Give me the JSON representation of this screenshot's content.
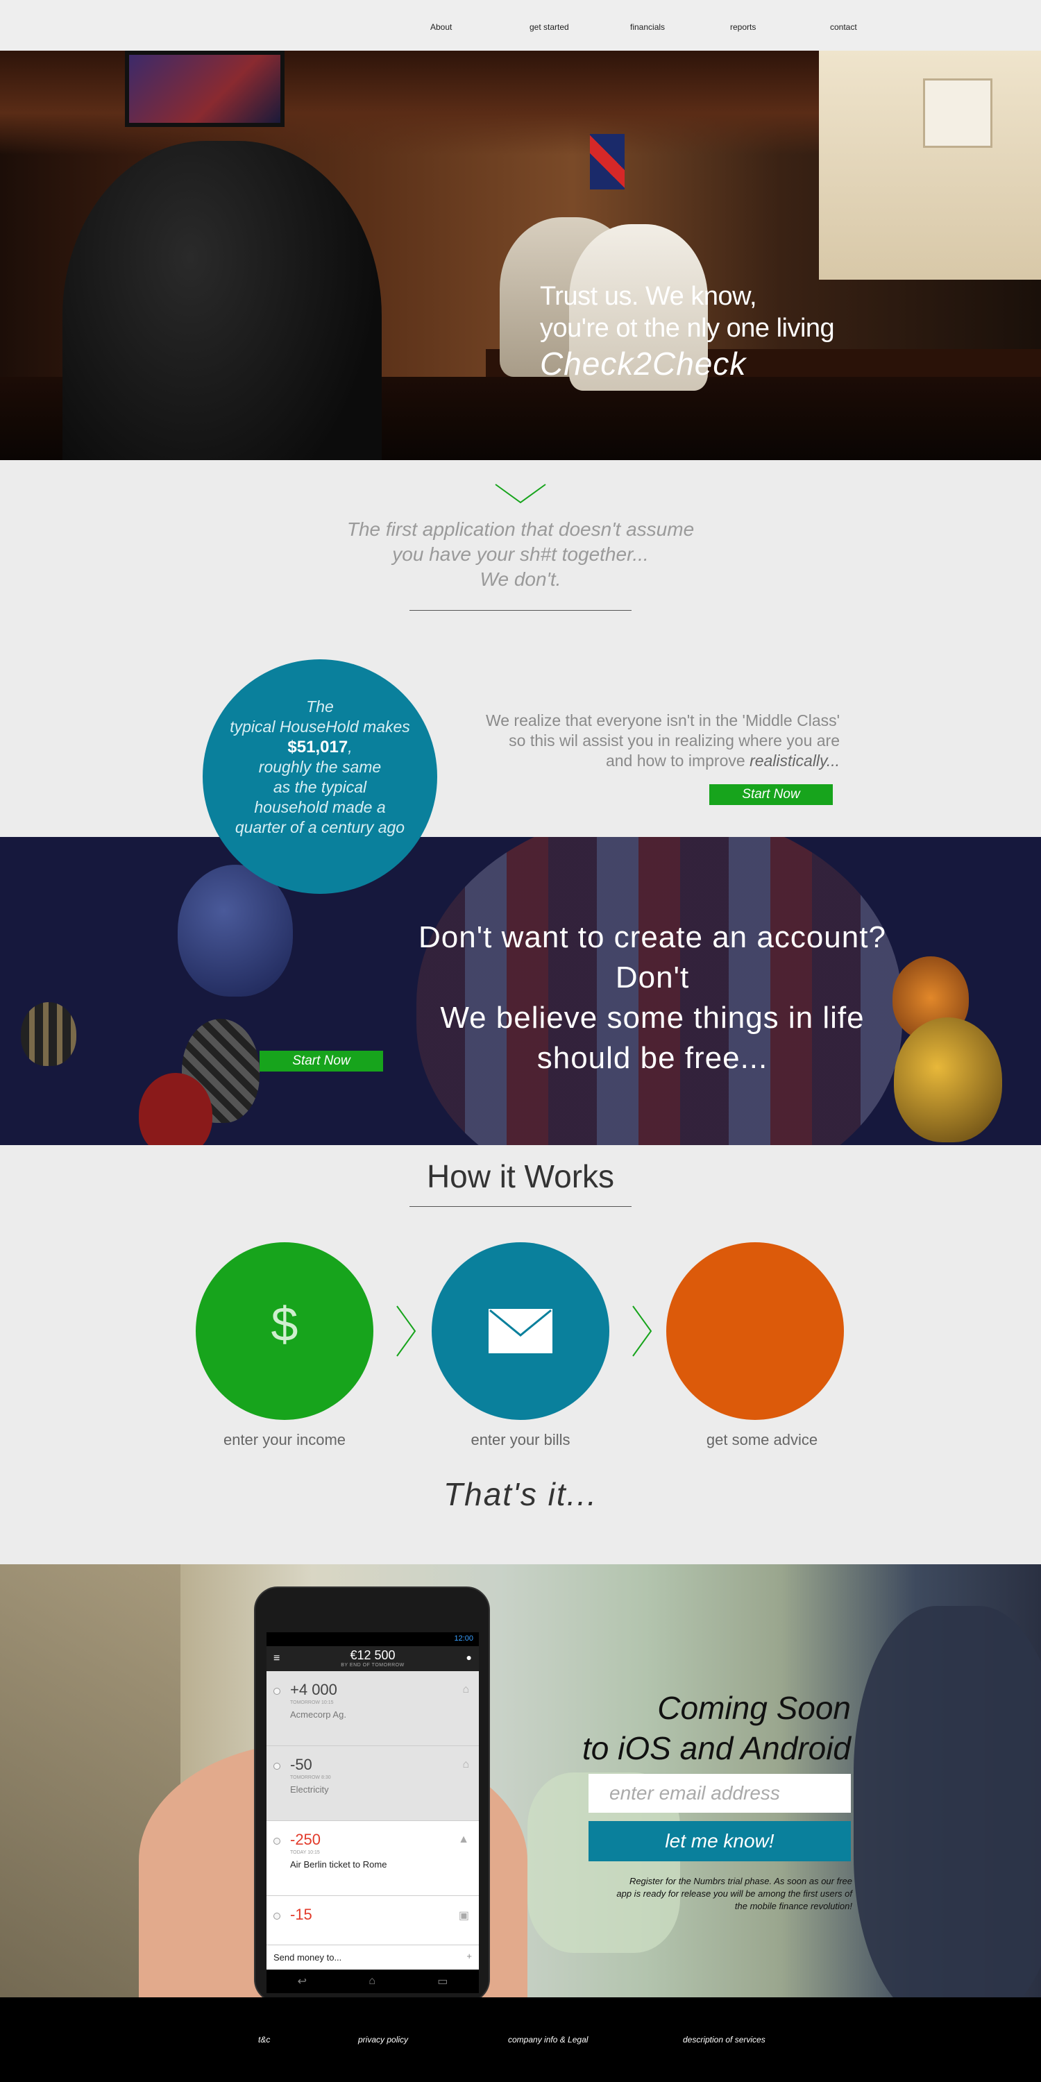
{
  "nav": {
    "items": [
      "About",
      "get started",
      "financials",
      "reports",
      "contact"
    ]
  },
  "hero": {
    "line1": "Trust  us. We know,",
    "line2": "you're ot the nly one living",
    "line3": "Check2Check"
  },
  "intro": {
    "line1": "The first application that doesn't assume",
    "line2": "you have your sh#t together...",
    "line3": "We don't."
  },
  "household": {
    "line1": "The",
    "line2": "typical HouseHold makes",
    "amount": "$51,017",
    "line3": "roughly the same",
    "line4": "as the typical",
    "line5": "household made a",
    "line6": "quarter of a century ago"
  },
  "realize": {
    "line1": "We realize that everyone isn't in the 'Middle Class'",
    "line2": "so this wil assist you in realizing where you are",
    "line3_prefix": "and how to improve ",
    "line3_emph": "realistically..."
  },
  "start_now_label": "Start Now",
  "free": {
    "line1": "Don't want to create an account?",
    "line2": "Don't",
    "line3": "We believe some things in life",
    "line4": "should be free..."
  },
  "how": {
    "title": "How it Works",
    "steps": [
      {
        "label": "enter your income",
        "color": "#17a41c",
        "icon": "dollar-icon",
        "glyph": "$"
      },
      {
        "label": "enter your bills",
        "color": "#0a809c",
        "icon": "envelope-icon"
      },
      {
        "label": "get some advice",
        "color": "#dc5a0a",
        "icon": ""
      }
    ],
    "closing": "That's it..."
  },
  "phone": {
    "time": "12:00",
    "balance": "€12 500",
    "balance_sub": "BY END OF TOMORROW",
    "transactions": [
      {
        "amount": "+4 000",
        "when": "TOMORROW 10:15",
        "who": "Acmecorp Ag.",
        "negative": false,
        "style": "grey",
        "icon": "bank-icon",
        "glyph": "⌂"
      },
      {
        "amount": "-50",
        "when": "TOMORROW 8:30",
        "who": "Electricity",
        "negative": false,
        "style": "grey",
        "icon": "home-icon",
        "glyph": "⌂"
      },
      {
        "amount": "-250",
        "when": "TODAY 10:15",
        "who": "Air Berlin ticket to Rome",
        "negative": true,
        "style": "white",
        "icon": "plane-icon",
        "glyph": "▲"
      },
      {
        "amount": "-15",
        "when": "",
        "who": "",
        "negative": true,
        "style": "white",
        "icon": "wallet-icon",
        "glyph": "▣"
      }
    ],
    "send_label": "Send money to..."
  },
  "coming": {
    "title1": "Coming Soon",
    "title2": "to iOS and Android",
    "email_placeholder": "enter email address",
    "button": "let me know!",
    "fine1": "Register for the Numbrs trial phase. As soon as our free",
    "fine2": "app is ready for release you will be among the first users of",
    "fine3": "the mobile finance revolution!"
  },
  "footer": {
    "links": [
      "t&c",
      "privacy policy",
      "company info & Legal",
      "description of services"
    ]
  },
  "colors": {
    "green": "#17a41c",
    "teal": "#0a809c",
    "orange": "#dc5a0a",
    "navy": "#16183d"
  }
}
